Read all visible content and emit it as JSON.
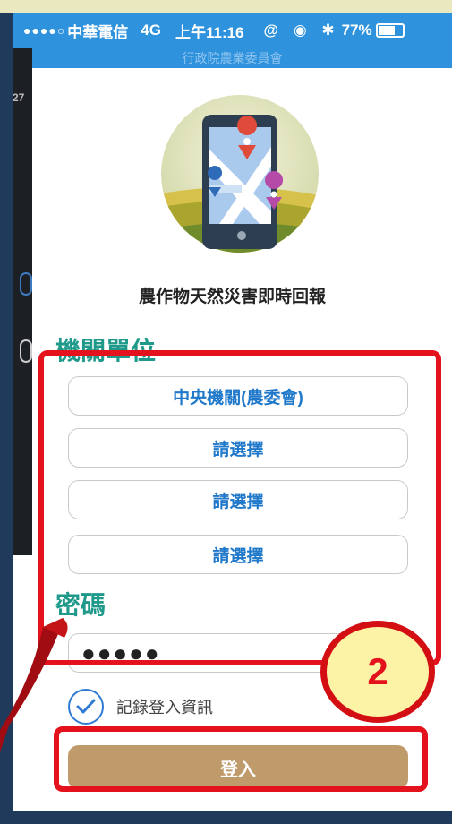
{
  "status_bar": {
    "signal": "●●●●○",
    "carrier": "中華電信",
    "network": "4G",
    "time": "上午11:16",
    "icons": "@ ◉ ✱",
    "battery": "77%"
  },
  "background_app": {
    "time": "27"
  },
  "nav_title": "行政院農業委員會",
  "app_title": "農作物天然災害即時回報",
  "agency": {
    "label": "機關單位",
    "options": [
      "中央機關(農委會)",
      "請選擇",
      "請選擇",
      "請選擇"
    ]
  },
  "password": {
    "label": "密碼",
    "value": "●●●●●"
  },
  "remember": {
    "label": "記錄登入資訊",
    "checked": true
  },
  "login_label": "登入",
  "annotation": {
    "step": "2",
    "color": "#e4121d"
  },
  "colors": {
    "status_bar": "#2f92dd",
    "section_title": "#1f9a8a",
    "option_text": "#1f78c9",
    "login_button": "#bf9a6b"
  }
}
